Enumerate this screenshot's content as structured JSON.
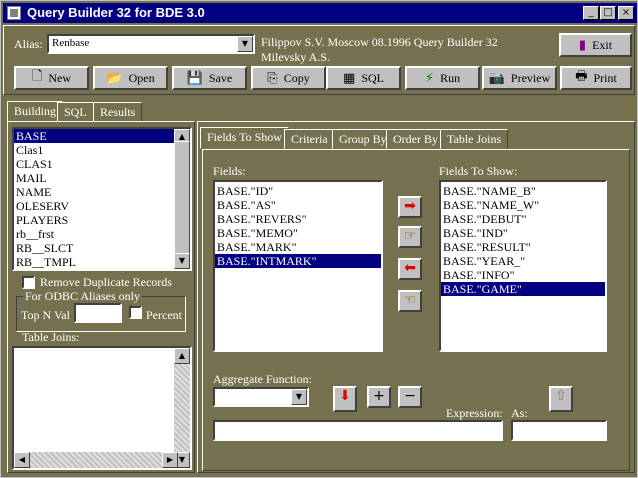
{
  "window": {
    "title": "Query Builder 32 for BDE 3.0",
    "min_glyph": "_",
    "max_glyph": "□",
    "close_glyph": "×"
  },
  "alias": {
    "label": "Alias:",
    "value": "Renbase"
  },
  "credits": {
    "line1": "Filippov  S.V.   Moscow 08.1996 Query Builder 32",
    "line2": "Milevsky A.S."
  },
  "toolbar": {
    "exit": "Exit",
    "new": "New",
    "open": "Open",
    "save": "Save",
    "copy": "Copy",
    "sql": "SQL",
    "run": "Run",
    "preview": "Preview",
    "print": "Print"
  },
  "left_tabs": {
    "building": "Building",
    "sql": "SQL",
    "results": "Results"
  },
  "tables": {
    "items": [
      "BASE",
      "Clas1",
      "CLAS1",
      "MAIL",
      "NAME",
      "OLESERV",
      "PLAYERS",
      "rb__frst",
      "RB__SLCT",
      "RB__TMPL"
    ],
    "selected_index": 0
  },
  "options": {
    "remove_duplicates": "Remove Duplicate Records",
    "odbc_group": "For ODBC Aliases only",
    "top_n": "Top N Val",
    "percent": "Percent",
    "table_joins": "Table Joins:"
  },
  "right_tabs": {
    "fields_to_show": "Fields To Show",
    "criteria": "Criteria",
    "group_by": "Group By",
    "order_by": "Order By",
    "table_joins": "Table Joins"
  },
  "fields": {
    "label": "Fields:",
    "items": [
      "BASE.\"ID\"",
      "BASE.\"AS\"",
      "BASE.\"REVERS\"",
      "BASE.\"MEMO\"",
      "BASE.\"MARK\"",
      "BASE.\"INTMARK\""
    ],
    "selected_index": 5
  },
  "show_fields": {
    "label": "Fields To Show:",
    "items": [
      "BASE.\"NAME_B\"",
      "BASE.\"NAME_W\"",
      "BASE.\"DEBUT\"",
      "BASE.\"IND\"",
      "BASE.\"RESULT\"",
      "BASE.\"YEAR_\"",
      "BASE.\"INFO\"",
      "BASE.\"GAME\""
    ],
    "selected_index": 7
  },
  "aggregate": {
    "label": "Aggregate Function:",
    "value": ""
  },
  "expression": {
    "label": "Expression:",
    "value": ""
  },
  "as_field": {
    "label": "As:",
    "value": ""
  },
  "colors": {
    "accent": "#000080",
    "panel": "#75714f",
    "face": "#c0c0c0"
  }
}
